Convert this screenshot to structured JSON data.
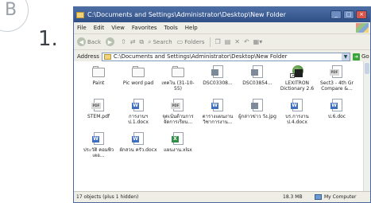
{
  "decor": {
    "letter": "B",
    "step": "1."
  },
  "window": {
    "title": "C:\\Documents and Settings\\Administrator\\Desktop\\New Folder",
    "controls": {
      "minimize": "_",
      "maximize": "□",
      "close": "×"
    }
  },
  "menu": [
    "File",
    "Edit",
    "View",
    "Favorites",
    "Tools",
    "Help"
  ],
  "toolbar": {
    "back": "Back",
    "search": "Search",
    "folders": "Folders"
  },
  "address": {
    "label": "Address",
    "path": "C:\\Documents and Settings\\Administrator\\Desktop\\New Folder",
    "go": "Go"
  },
  "files": [
    {
      "name": "Paint",
      "icon": "folder-icon",
      "kind": "folder"
    },
    {
      "name": "Pic word pad",
      "icon": "folder-icon",
      "kind": "folder"
    },
    {
      "name": "เทคโน (31-10-55)",
      "icon": "folder-icon",
      "kind": "folder"
    },
    {
      "name": "DSC03308...",
      "icon": "image-file-icon",
      "kind": "img"
    },
    {
      "name": "DSC03854...",
      "icon": "image-file-icon",
      "kind": "img"
    },
    {
      "name": "LEXITRON Dictionary 2.6",
      "icon": "lexitron-shortcut-icon",
      "kind": "lexi"
    },
    {
      "name": "Sect3 - 4th Gr Compare &...",
      "icon": "pdf-file-icon",
      "kind": "pdf"
    },
    {
      "name": "STEM.pdf",
      "icon": "pdf-file-icon",
      "kind": "pdf"
    },
    {
      "name": "การงานฯ ป.1.docx",
      "icon": "word-document-icon",
      "kind": "word"
    },
    {
      "name": "จุดเน้นด้านการ จัดการเรียน...",
      "icon": "pdf-file-icon",
      "kind": "pdf"
    },
    {
      "name": "ตารางแผนงาน วิชาการงาน...",
      "icon": "word-document-icon",
      "kind": "word"
    },
    {
      "name": "ผู้กล่าวข่าว วัง.jpg",
      "icon": "image-file-icon",
      "kind": "img"
    },
    {
      "name": "บร.การงาน ป.4.docx",
      "icon": "word-document-icon",
      "kind": "word"
    },
    {
      "name": "ป.6.doc",
      "icon": "word-document-icon",
      "kind": "word"
    },
    {
      "name": "ประวัติ คอมพิวเตอ...",
      "icon": "word-document-icon",
      "kind": "word"
    },
    {
      "name": "ผักสวน ครัว.docx",
      "icon": "word-document-icon",
      "kind": "word"
    },
    {
      "name": "แผนงาน.xlsx",
      "icon": "excel-file-icon",
      "kind": "xls"
    }
  ],
  "status": {
    "objects": "17 objects (plus 1 hidden)",
    "size": "18.3 MB",
    "zone": "My Computer"
  }
}
